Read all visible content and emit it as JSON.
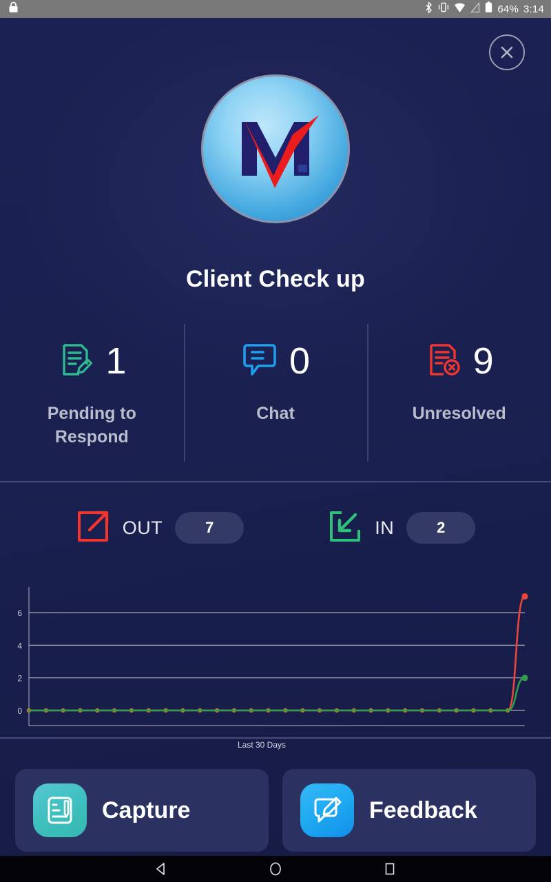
{
  "statusbar": {
    "lock_icon": "lock-icon",
    "bluetooth_icon": "bluetooth-icon",
    "vibrate_icon": "vibrate-icon",
    "wifi_icon": "wifi-icon",
    "signal_icon": "signal-icon",
    "battery_icon": "battery-icon",
    "battery_level": "64%",
    "time": "3:14"
  },
  "card": {
    "close_label": "×",
    "logo_letter": "M",
    "title": "Client Check up"
  },
  "stats": [
    {
      "icon": "document-edit-icon",
      "value": "1",
      "label": "Pending to Respond",
      "color": "#2fb98f"
    },
    {
      "icon": "chat-bubble-icon",
      "value": "0",
      "label": "Chat",
      "color": "#1f9ff0"
    },
    {
      "icon": "document-error-icon",
      "value": "9",
      "label": "Unresolved",
      "color": "#f0362e"
    }
  ],
  "inout": {
    "out": {
      "icon": "arrow-out-icon",
      "label": "OUT",
      "value": "7",
      "color": "#f0362e"
    },
    "in": {
      "icon": "arrow-in-icon",
      "label": "IN",
      "value": "2",
      "color": "#2fc07a"
    }
  },
  "chart_data": {
    "type": "line",
    "title": "",
    "xlabel": "Last 30 Days",
    "ylabel": "",
    "ylim": [
      0,
      7.4
    ],
    "yticks": [
      0,
      2,
      4,
      6
    ],
    "grid": true,
    "legend": false,
    "x": [
      1,
      2,
      3,
      4,
      5,
      6,
      7,
      8,
      9,
      10,
      11,
      12,
      13,
      14,
      15,
      16,
      17,
      18,
      19,
      20,
      21,
      22,
      23,
      24,
      25,
      26,
      27,
      28,
      29,
      30
    ],
    "series": [
      {
        "name": "OUT",
        "color": "#e8453c",
        "values": [
          0,
          0,
          0,
          0,
          0,
          0,
          0,
          0,
          0,
          0,
          0,
          0,
          0,
          0,
          0,
          0,
          0,
          0,
          0,
          0,
          0,
          0,
          0,
          0,
          0,
          0,
          0,
          0,
          0,
          7
        ]
      },
      {
        "name": "IN",
        "color": "#2f9e4f",
        "values": [
          0,
          0,
          0,
          0,
          0,
          0,
          0,
          0,
          0,
          0,
          0,
          0,
          0,
          0,
          0,
          0,
          0,
          0,
          0,
          0,
          0,
          0,
          0,
          0,
          0,
          0,
          0,
          0,
          0,
          2
        ]
      }
    ],
    "marker_color": "#b0812a"
  },
  "actions": [
    {
      "icon": "capture-icon",
      "label": "Capture"
    },
    {
      "icon": "feedback-icon",
      "label": "Feedback"
    }
  ],
  "navbar": [
    {
      "icon": "back-icon"
    },
    {
      "icon": "home-icon"
    },
    {
      "icon": "recents-icon"
    }
  ]
}
